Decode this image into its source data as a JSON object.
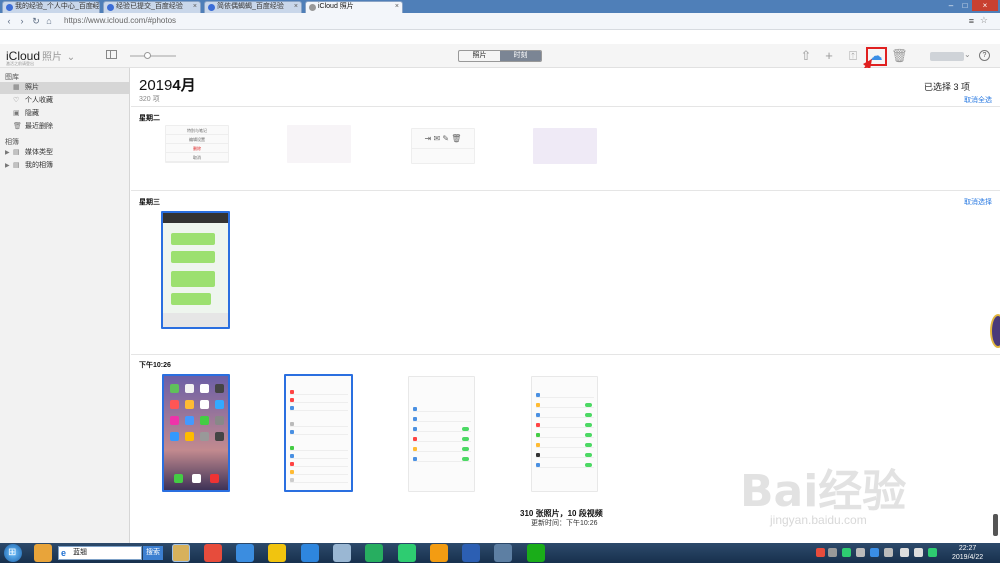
{
  "browser": {
    "tabs": [
      {
        "label": "我的经验_个人中心_百度经",
        "active": false
      },
      {
        "label": "经验已提交_百度经验",
        "active": false
      },
      {
        "label": "简依偶蝎蝎_百度经验",
        "active": false
      },
      {
        "label": "iCloud 照片",
        "active": true
      }
    ],
    "url": "https://www.icloud.com/#photos"
  },
  "toolbar": {
    "brand": "iCloud",
    "app": "照片",
    "brand_note": "激活之前请登出",
    "segments": [
      "照片",
      "时刻"
    ],
    "active_segment": "时刻",
    "icons": [
      "upload-icon",
      "add-icon",
      "share-icon",
      "download-icon",
      "trash-icon"
    ],
    "highlighted_icon": "download-icon",
    "help": "?"
  },
  "sidebar": {
    "library_header": "图库",
    "library_items": [
      {
        "label": "照片",
        "icon": "photos-icon",
        "selected": true
      },
      {
        "label": "个人收藏",
        "icon": "heart-icon",
        "selected": false
      },
      {
        "label": "隐藏",
        "icon": "hidden-icon",
        "selected": false
      },
      {
        "label": "最近删除",
        "icon": "trash-icon",
        "selected": false
      }
    ],
    "albums_header": "相簿",
    "album_items": [
      {
        "label": "媒体类型",
        "icon": "folder-icon"
      },
      {
        "label": "我的相簿",
        "icon": "folder-icon"
      }
    ]
  },
  "main": {
    "month_year": "2019",
    "month": "4月",
    "count": "320 项",
    "selected_text": "已选择 3 项",
    "deselect_label": "取消全选",
    "sections": [
      {
        "title": "星期二",
        "deselect": "取消全选"
      },
      {
        "title": "星期三",
        "deselect": "取消选择"
      },
      {
        "title": "下午10:26",
        "deselect": ""
      }
    ],
    "thumb_menu": [
      "特别与笔记",
      "编辑设置",
      "删除",
      "取消"
    ],
    "footer_count": "310 张照片，10 段视频",
    "footer_time": "更新时间：下午10:26"
  },
  "taskbar": {
    "search_value": "蓝翘",
    "search_button": "搜索",
    "time": "22:27",
    "date": "2019/4/22"
  },
  "watermark": {
    "logo": "Bai经验",
    "url": "jingyan.baidu.com"
  },
  "colors": {
    "accent": "#2a6fe0",
    "highlight": "#e02020",
    "link": "#2a7ae2"
  }
}
